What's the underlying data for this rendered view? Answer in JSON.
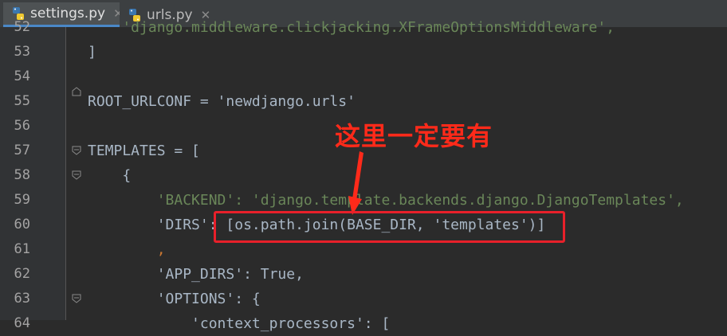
{
  "tabs": [
    {
      "label": "settings.py",
      "active": true
    },
    {
      "label": "urls.py",
      "active": false
    }
  ],
  "code_lines": [
    {
      "num": "52",
      "text": "    'django.middleware.clickjacking.XFrameOptionsMiddleware',"
    },
    {
      "num": "53",
      "text": "]"
    },
    {
      "num": "54",
      "text": ""
    },
    {
      "num": "55",
      "text": "ROOT_URLCONF = 'newdjango.urls'"
    },
    {
      "num": "56",
      "text": ""
    },
    {
      "num": "57",
      "text": "TEMPLATES = ["
    },
    {
      "num": "58",
      "text": "    {"
    },
    {
      "num": "59",
      "text": "        'BACKEND': 'django.template.backends.django.DjangoTemplates',"
    },
    {
      "num": "60",
      "text": "        'DIRS': [os.path.join(BASE_DIR, 'templates')]"
    },
    {
      "num": "61",
      "text": "        ,"
    },
    {
      "num": "62",
      "text": "        'APP_DIRS': True,"
    },
    {
      "num": "63",
      "text": "        'OPTIONS': {"
    },
    {
      "num": "64",
      "text": "            'context_processors': ["
    }
  ],
  "annotation": "这里一定要有",
  "colors": {
    "highlight": "#e8202a",
    "annotation": "#ff2a1a",
    "accent": "#4a88c7"
  },
  "icons": {
    "file": "python-file-icon",
    "close": "close-icon",
    "fold": "fold-marker-icon"
  }
}
